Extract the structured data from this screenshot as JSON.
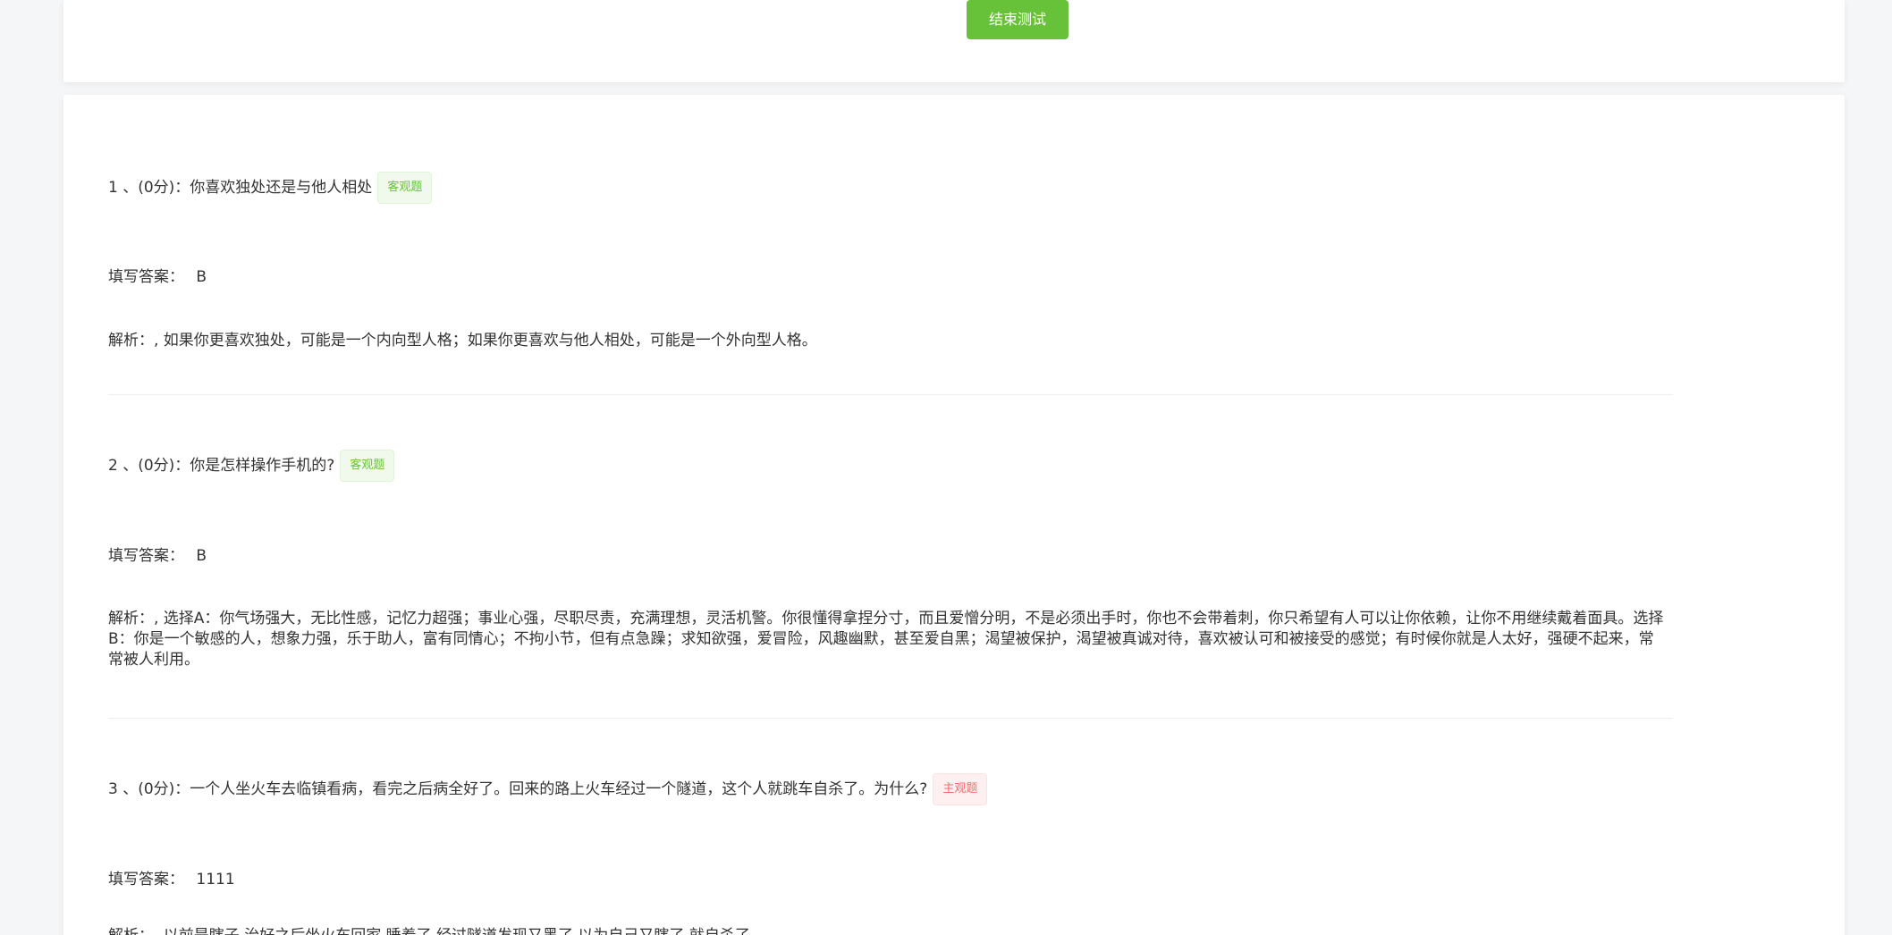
{
  "top": {
    "end_button": "结束测试"
  },
  "questions": [
    {
      "title": "1 、(0分)：你喜欢独处还是与他人相处",
      "tag": "客观题",
      "answer_label": "填写答案：",
      "answer_value": "B",
      "analysis": "解析：, 如果你更喜欢独处，可能是一个内向型人格；如果你更喜欢与他人相处，可能是一个外向型人格。"
    },
    {
      "title": "2 、(0分)：你是怎样操作手机的?",
      "tag": "客观题",
      "answer_label": "填写答案：",
      "answer_value": "B",
      "analysis": "解析：, 选择A：你气场强大，无比性感，记忆力超强；事业心强，尽职尽责，充满理想，灵活机警。你很懂得拿捏分寸，而且爱憎分明，不是必须出手时，你也不会带着刺，你只希望有人可以让你依赖，让你不用继续戴着面具。选择B：你是一个敏感的人，想象力强，乐于助人，富有同情心；不拘小节，但有点急躁；求知欲强，爱冒险，风趣幽默，甚至爱自黑；渴望被保护，渴望被真诚对待，喜欢被认可和被接受的感觉；有时候你就是人太好，强硬不起来，常常被人利用。"
    },
    {
      "title": "3 、(0分)：一个人坐火车去临镇看病，看完之后病全好了。回来的路上火车经过一个隧道，这个人就跳车自杀了。为什么?",
      "tag": "主观题",
      "answer_label": "填写答案：",
      "answer_value": "1111",
      "analysis": "解析：, 以前是瞎子,治好之后坐火车回家,睡着了,经过隧道发现又黑了,以为自己又瞎了,就自杀了。"
    }
  ],
  "colors": {
    "primary_green": "#67c23a",
    "tag_objective": "#67c23a",
    "tag_subjective": "#f56c6c"
  }
}
